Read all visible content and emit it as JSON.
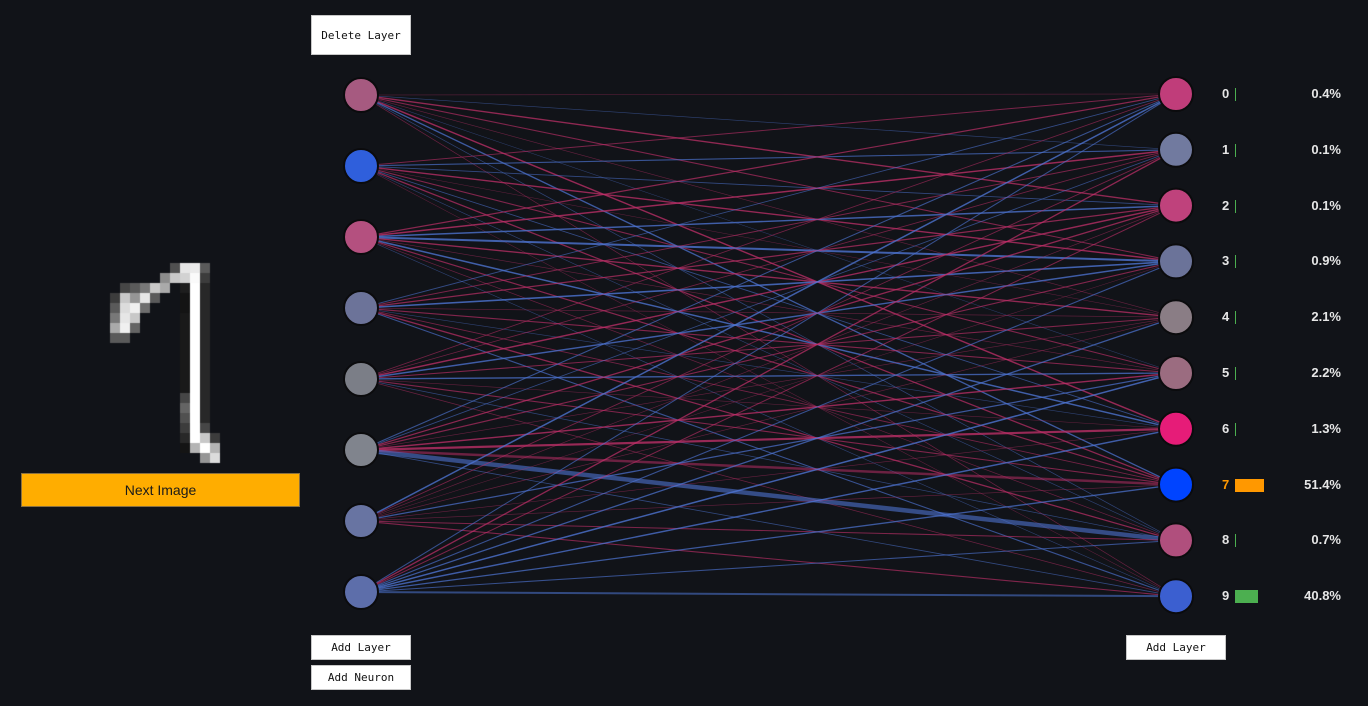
{
  "buttons": {
    "delete_layer": "Delete Layer",
    "add_layer_left": "Add Layer",
    "add_neuron": "Add Neuron",
    "add_layer_right": "Add Layer",
    "next_image": "Next Image"
  },
  "input_image": {
    "description_icon": "handwritten-digit-image",
    "grid_size": 28
  },
  "colors": {
    "background": "#111318",
    "positive_weight": "#4f76d6",
    "negative_weight": "#c2306a",
    "predicted_label": "#ff9800",
    "next_button": "#ffad00",
    "bar_default": "#4caf50",
    "bar_predicted": "#ff9800"
  },
  "hidden_layer": {
    "neurons": [
      {
        "color": "#a65a80"
      },
      {
        "color": "#2f5fdc"
      },
      {
        "color": "#b4507f"
      },
      {
        "color": "#6c7399"
      },
      {
        "color": "#7b7e87"
      },
      {
        "color": "#80848d"
      },
      {
        "color": "#6874a2"
      },
      {
        "color": "#5d6eaa"
      }
    ]
  },
  "output_layer": {
    "predicted_index": 7,
    "neurons": [
      {
        "label": "0",
        "prob_text": "0.4%",
        "prob": 0.004,
        "color": "#c03d7a"
      },
      {
        "label": "1",
        "prob_text": "0.1%",
        "prob": 0.001,
        "color": "#717a9f"
      },
      {
        "label": "2",
        "prob_text": "0.1%",
        "prob": 0.001,
        "color": "#bf427c"
      },
      {
        "label": "3",
        "prob_text": "0.9%",
        "prob": 0.009,
        "color": "#6b7399"
      },
      {
        "label": "4",
        "prob_text": "2.1%",
        "prob": 0.021,
        "color": "#8a7d85"
      },
      {
        "label": "5",
        "prob_text": "2.2%",
        "prob": 0.022,
        "color": "#9b6c80"
      },
      {
        "label": "6",
        "prob_text": "1.3%",
        "prob": 0.013,
        "color": "#e61c78"
      },
      {
        "label": "7",
        "prob_text": "51.4%",
        "prob": 0.514,
        "color": "#0044ff"
      },
      {
        "label": "8",
        "prob_text": "0.7%",
        "prob": 0.007,
        "color": "#b04f7d"
      },
      {
        "label": "9",
        "prob_text": "40.8%",
        "prob": 0.408,
        "color": "#3b5fd0"
      }
    ]
  }
}
